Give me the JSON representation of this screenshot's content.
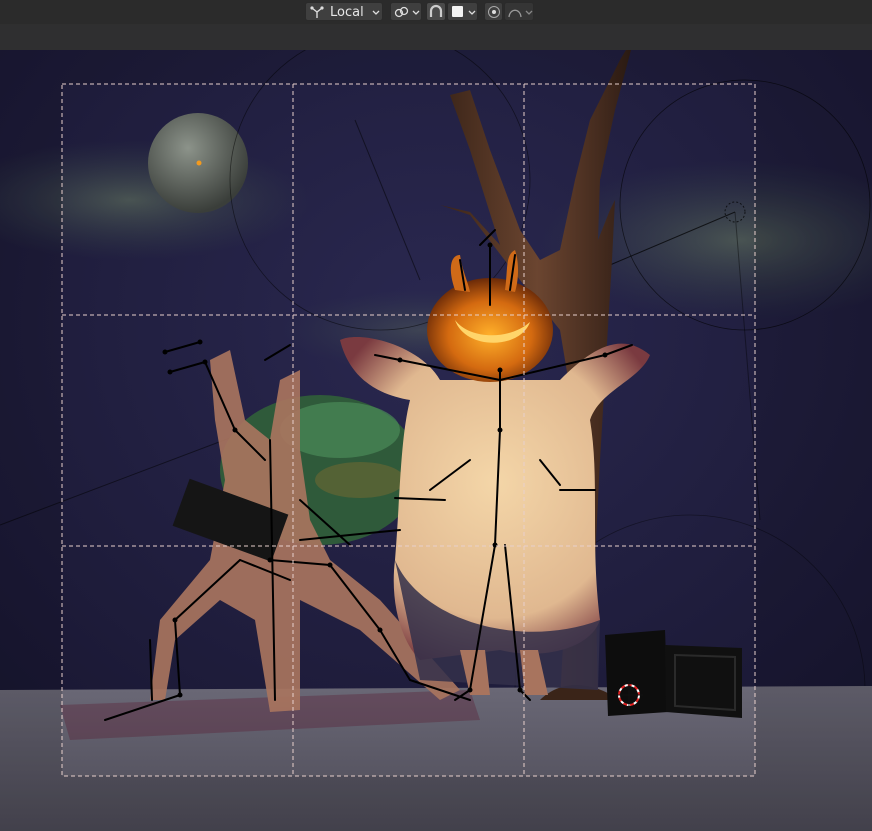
{
  "header": {
    "transform_orientation_label": "Local",
    "icons": [
      "transform-orientation-icon",
      "chevron-down-icon",
      "pivot-point-icon",
      "snap-icon",
      "snap-target-icon",
      "proportional-editing-icon",
      "falloff-curve-icon"
    ]
  },
  "colors": {
    "header_bg": "#2b2b2b",
    "button_bg": "#3f3f3f",
    "sky": "#1d1b3a",
    "ground": "#5c5a66",
    "pumpkin_glow": "#f4a020",
    "camera_frame": "#e8d0cc"
  },
  "viewport": {
    "camera_frame_guides": "thirds"
  }
}
